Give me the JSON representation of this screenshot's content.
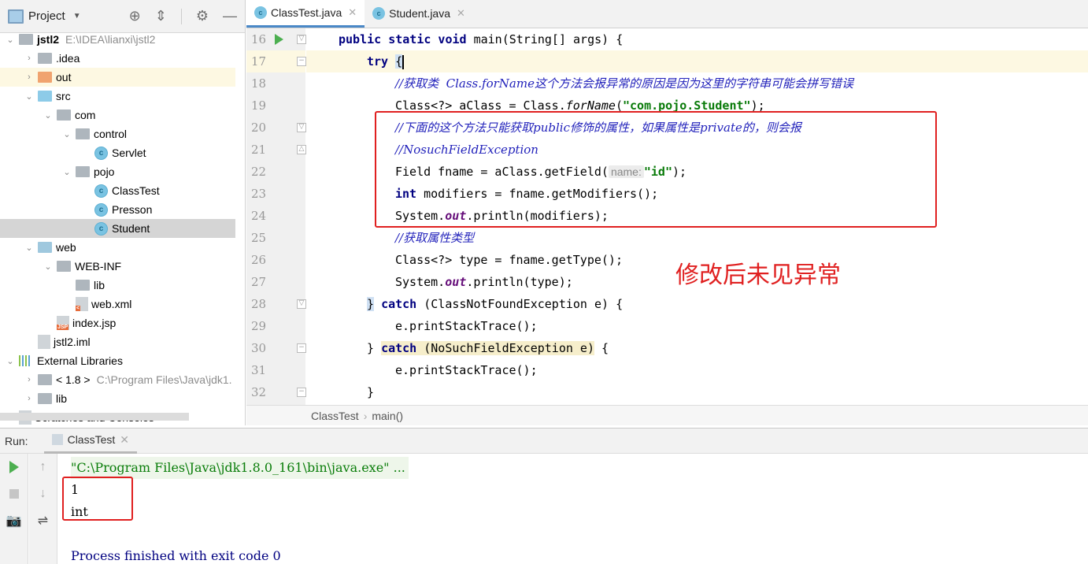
{
  "project_panel": {
    "title": "Project",
    "tree": [
      {
        "label": "jstl2",
        "path": "E:\\IDEA\\lianxi\\jstl2",
        "level": 0,
        "expanded": true,
        "icon": "module-folder-icon"
      },
      {
        "label": ".idea",
        "level": 1,
        "expanded": false,
        "icon": "folder-icon"
      },
      {
        "label": "out",
        "level": 1,
        "expanded": false,
        "icon": "folder-orange-icon"
      },
      {
        "label": "src",
        "level": 1,
        "expanded": true,
        "icon": "source-folder-icon"
      },
      {
        "label": "com",
        "level": 2,
        "expanded": true,
        "icon": "package-icon"
      },
      {
        "label": "control",
        "level": 3,
        "expanded": true,
        "icon": "package-icon"
      },
      {
        "label": "Servlet",
        "level": 4,
        "icon": "class-icon"
      },
      {
        "label": "pojo",
        "level": 3,
        "expanded": true,
        "icon": "package-icon"
      },
      {
        "label": "ClassTest",
        "level": 4,
        "icon": "class-runnable-icon"
      },
      {
        "label": "Presson",
        "level": 4,
        "icon": "class-icon"
      },
      {
        "label": "Student",
        "level": 4,
        "icon": "class-icon",
        "selected": true
      },
      {
        "label": "web",
        "level": 1,
        "expanded": true,
        "icon": "web-folder-icon"
      },
      {
        "label": "WEB-INF",
        "level": 2,
        "expanded": true,
        "icon": "folder-icon"
      },
      {
        "label": "lib",
        "level": 3,
        "icon": "folder-icon"
      },
      {
        "label": "web.xml",
        "level": 3,
        "icon": "xml-file-icon"
      },
      {
        "label": "index.jsp",
        "level": 2,
        "icon": "jsp-file-icon"
      },
      {
        "label": "jstl2.iml",
        "level": 1,
        "icon": "iml-file-icon"
      },
      {
        "label": "External Libraries",
        "level": 0,
        "expanded": true,
        "icon": "libraries-icon"
      },
      {
        "label": "< 1.8 >",
        "path": "C:\\Program Files\\Java\\jdk1.",
        "level": 1,
        "expanded": false,
        "icon": "jdk-icon"
      },
      {
        "label": "lib",
        "level": 1,
        "expanded": false,
        "icon": "library-icon"
      },
      {
        "label": "Scratches and Consoles",
        "level": 0,
        "icon": "scratches-icon"
      }
    ]
  },
  "editor": {
    "tabs": [
      {
        "label": "ClassTest.java",
        "active": true
      },
      {
        "label": "Student.java",
        "active": false
      }
    ],
    "line_numbers": [
      "16",
      "17",
      "18",
      "19",
      "20",
      "21",
      "22",
      "23",
      "24",
      "25",
      "26",
      "27",
      "28",
      "29",
      "30",
      "31",
      "32"
    ],
    "code": {
      "l16": {
        "kw": "public static void",
        "rest": " main(String[] args) {"
      },
      "l17": {
        "kw": "try",
        "brace": "{"
      },
      "l18": {
        "comment": "//获取类  Class.forName这个方法会报异常的原因是因为这里的字符串可能会拼写错误"
      },
      "l19": {
        "a": "Class<?> aClass = Class.",
        "method": "forName",
        "b": "(",
        "str": "\"com.pojo.Student\"",
        "c": ");"
      },
      "l20": {
        "comment": "//下面的这个方法只能获取public修饰的属性，如果属性是private的，则会报"
      },
      "l21": {
        "comment": "//NosuchFieldException"
      },
      "l22": {
        "a": "Field fname = aClass.getField(",
        "hint": "name:",
        "str": "\"id\"",
        "c": ");"
      },
      "l23": {
        "kw": "int",
        "rest": " modifiers = fname.getModifiers();"
      },
      "l24": {
        "a": "System.",
        "field": "out",
        "c": ".println(modifiers);"
      },
      "l25": {
        "comment": "//获取属性类型"
      },
      "l26": {
        "a": "Class<?> type = fname.getType();"
      },
      "l27": {
        "a": "System.",
        "field": "out",
        "c": ".println(type);"
      },
      "l28": {
        "brace": "}",
        "kw": "catch",
        "rest": " (ClassNotFoundException e) {"
      },
      "l29": {
        "a": "e.printStackTrace();"
      },
      "l30": {
        "brace": "}",
        "kw": "catch",
        "rest": " (NoSuchFieldException e)",
        "end": " {"
      },
      "l31": {
        "a": "e.printStackTrace();"
      },
      "l32": {
        "brace": "}"
      }
    },
    "annotation": "修改后未见异常",
    "breadcrumb": [
      "ClassTest",
      "main()"
    ]
  },
  "run_panel": {
    "label": "Run:",
    "tab": "ClassTest",
    "console": {
      "command": "\"C:\\Program Files\\Java\\jdk1.8.0_161\\bin\\java.exe\" ...",
      "output": [
        "1",
        "int"
      ],
      "blank": "",
      "finish": "Process finished with exit code 0"
    }
  },
  "colors": {
    "annotation_red": "#e02020",
    "keyword": "#000080",
    "comment": "#2222bb",
    "string": "#087a08",
    "static_field": "#660e7a",
    "run_green": "#4caf50",
    "tab_accent": "#4a88c7"
  }
}
